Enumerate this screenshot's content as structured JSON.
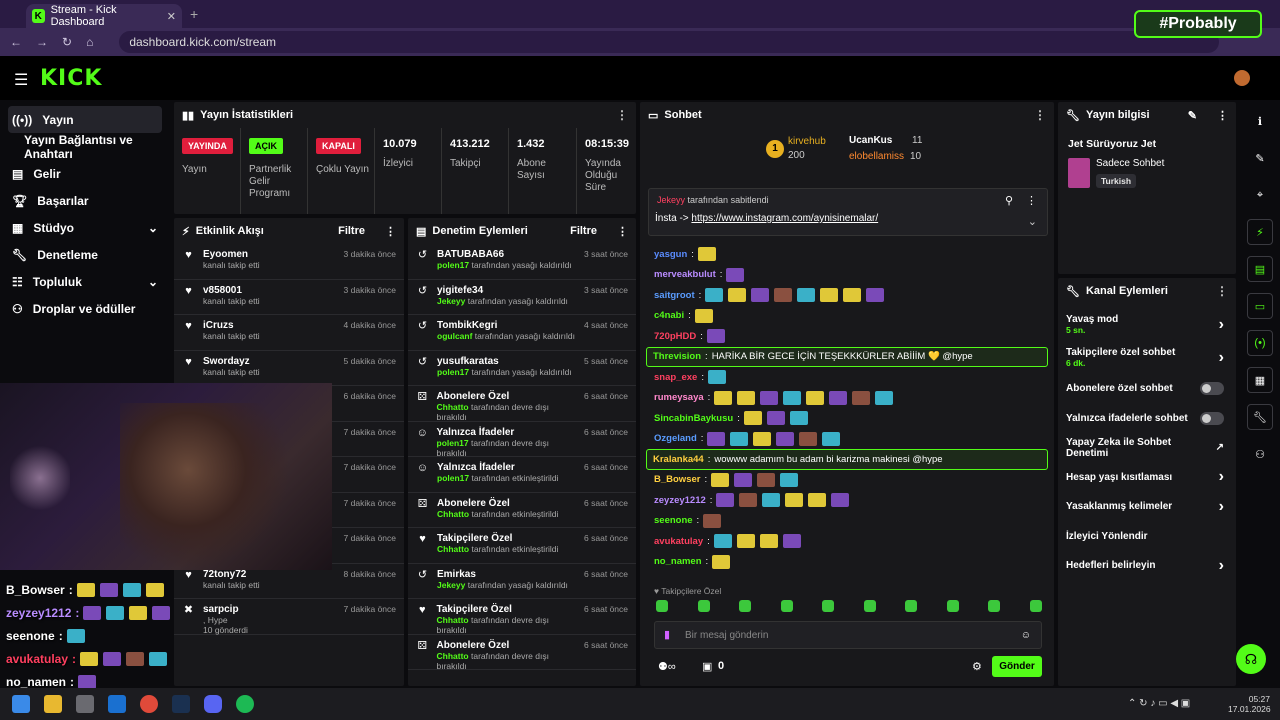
{
  "browser": {
    "tab_title": "Stream - Kick Dashboard",
    "url": "dashboard.kick.com/stream",
    "watermark": "#Probably"
  },
  "logo": "KICK",
  "sidebar": {
    "items": [
      {
        "label": "Yayın",
        "icon": "broadcast-icon"
      },
      {
        "label": "Yayın Bağlantısı ve Anahtarı",
        "icon": ""
      },
      {
        "label": "Gelir",
        "icon": "money-icon"
      },
      {
        "label": "Başarılar",
        "icon": "trophy-icon"
      },
      {
        "label": "Stüdyo",
        "icon": "studio-icon"
      },
      {
        "label": "Denetleme",
        "icon": "wrench-icon"
      },
      {
        "label": "Topluluk",
        "icon": "community-icon"
      },
      {
        "label": "Droplar ve ödüller",
        "icon": "gift-icon"
      }
    ]
  },
  "stats": {
    "title": "Yayın İstatistikleri",
    "live_badge": "YAYINDA",
    "live_label": "Yayın",
    "partner_badge": "AÇIK",
    "partner_label": "Partnerlik Gelir Programı",
    "multi_badge": "KAPALI",
    "multi_label": "Çoklu Yayın",
    "viewers": "10.079",
    "viewers_label": "İzleyici",
    "followers": "413.212",
    "followers_label": "Takipçi",
    "subs": "1.432",
    "subs_label": "Abone Sayısı",
    "uptime": "08:15:39",
    "uptime_label": "Yayında Olduğu Süre"
  },
  "activity": {
    "title": "Etkinlik Akışı",
    "filter": "Filtre",
    "rows": [
      {
        "name": "Eyoomen",
        "sub": "kanalı takip etti",
        "time": "3 dakika önce"
      },
      {
        "name": "v858001",
        "sub": "kanalı takip etti",
        "time": "3 dakika önce"
      },
      {
        "name": "iCruzs",
        "sub": "kanalı takip etti",
        "time": "4 dakika önce"
      },
      {
        "name": "Swordayz",
        "sub": "kanalı takip etti",
        "time": "5 dakika önce"
      },
      {
        "name": "",
        "sub": "",
        "time": "6 dakika önce"
      },
      {
        "name": "",
        "sub": "",
        "time": "7 dakika önce"
      },
      {
        "name": "",
        "sub": "",
        "time": "7 dakika önce"
      },
      {
        "name": "",
        "sub": "",
        "time": "7 dakika önce"
      },
      {
        "name": "",
        "sub": "10 gönderdi",
        "time": "7 dakika önce"
      },
      {
        "name": "72tony72",
        "sub": "kanalı takip etti",
        "time": "8 dakika önce"
      },
      {
        "name": "sarpcip",
        "sub": ", Hype",
        "sub2": "10 gönderdi",
        "time": "7 dakika önce"
      }
    ]
  },
  "moderation": {
    "title": "Denetim Eylemleri",
    "filter": "Filtre",
    "rows": [
      {
        "name": "BATUBABA66",
        "who": "polen17",
        "sub": "tarafından yasağı kaldırıldı",
        "time": "3 saat önce"
      },
      {
        "name": "yigitefe34",
        "who": "Jekeyy",
        "sub": "tarafından yasağı kaldırıldı",
        "time": "3 saat önce"
      },
      {
        "name": "TombikKegri",
        "who": "ogulcanf",
        "sub": "tarafından yasağı kaldırıldı",
        "time": "4 saat önce"
      },
      {
        "name": "yusufkaratas",
        "who": "polen17",
        "sub": "tarafından yasağı kaldırıldı",
        "time": "5 saat önce"
      },
      {
        "name": "Abonelere Özel",
        "who": "Chhatto",
        "sub": "tarafından devre dışı bırakıldı",
        "time": "6 saat önce"
      },
      {
        "name": "Yalnızca İfadeler",
        "who": "polen17",
        "sub": "tarafından devre dışı bırakıldı",
        "time": "6 saat önce"
      },
      {
        "name": "Yalnızca İfadeler",
        "who": "polen17",
        "sub": "tarafından etkinleştirildi",
        "time": "6 saat önce"
      },
      {
        "name": "Abonelere Özel",
        "who": "Chhatto",
        "sub": "tarafından etkinleştirildi",
        "time": "6 saat önce"
      },
      {
        "name": "Takipçilere Özel",
        "who": "Chhatto",
        "sub": "tarafından etkinleştirildi",
        "time": "6 saat önce"
      },
      {
        "name": "Emirkas",
        "who": "Jekeyy",
        "sub": "tarafından yasağı kaldırıldı",
        "time": "6 saat önce"
      },
      {
        "name": "Takipçilere Özel",
        "who": "Chhatto",
        "sub": "tarafından devre dışı bırakıldı",
        "time": "6 saat önce"
      },
      {
        "name": "Abonelere Özel",
        "who": "Chhatto",
        "sub": "tarafından devre dışı bırakıldı",
        "time": "6 saat önce"
      }
    ]
  },
  "chat": {
    "title": "Sohbet",
    "top_gifter": "kirvehub",
    "top_count": "200",
    "g1": "UcanKus",
    "g1n": "11",
    "g2": "elobellamiss",
    "g2n": "10",
    "pinned_by": "Jekeyy",
    "pinned_text": "tarafından sabitlendi",
    "pinned_msg": "İnsta ->",
    "pinned_link": "https://www.instagram.com/aynisinemalar/",
    "lines": [
      {
        "user": "yasgun",
        "color": "#5a8cff",
        "emotes": 1
      },
      {
        "user": "merveakbulut",
        "color": "#b98cff",
        "emotes": 1
      },
      {
        "user": "saitgroot",
        "color": "#5a9cff",
        "emotes": 8
      },
      {
        "user": "c4nabi",
        "color": "#53fc18",
        "emotes": 1
      },
      {
        "user": "720pHDD",
        "color": "#ff4060",
        "emotes": 1
      },
      {
        "user": "Threvision",
        "color": "#53fc18",
        "msg": "HARİKA BİR GECE İÇİN TEŞEKKKÜRLER ABİİİM 💛 @hype",
        "hl": true
      },
      {
        "user": "snap_exe",
        "color": "#ff4060",
        "emotes": 1
      },
      {
        "user": "rumeysaya",
        "color": "#ff88cc",
        "emotes": 8
      },
      {
        "user": "SincabinBaykusu",
        "color": "#53fc18",
        "emotes": 3
      },
      {
        "user": "Ozgeland",
        "color": "#5a9cff",
        "emotes": 6
      },
      {
        "user": "Kralanka44",
        "color": "#ffd040",
        "msg": "wowww adamım bu adam bi karizma makinesi @hype",
        "hl": true
      },
      {
        "user": "B_Bowser",
        "color": "#ffd040",
        "emotes": 4
      },
      {
        "user": "zeyzey1212",
        "color": "#b98cff",
        "emotes": 6
      },
      {
        "user": "seenone",
        "color": "#53fc18",
        "emotes": 1
      },
      {
        "user": "avukatulay",
        "color": "#ff4060",
        "emotes": 4
      },
      {
        "user": "no_namen",
        "color": "#53fc18",
        "emotes": 1
      }
    ],
    "mode": "Takipçilere Özel",
    "placeholder": "Bir mesaj gönderin",
    "send": "Gönder",
    "viewers_count": "0"
  },
  "info": {
    "title": "Yayın bilgisi",
    "stream_title": "Jet Sürüyoruz Jet",
    "category": "Sadece Sohbet",
    "tag": "Turkish"
  },
  "actions": {
    "title": "Kanal Eylemleri",
    "items": [
      {
        "label": "Yavaş mod",
        "sub": "5 sn.",
        "type": "arrow"
      },
      {
        "label": "Takipçilere özel sohbet",
        "sub": "6 dk.",
        "type": "arrow"
      },
      {
        "label": "Abonelere özel sohbet",
        "type": "toggle"
      },
      {
        "label": "Yalnızca ifadelerle sohbet",
        "type": "toggle"
      },
      {
        "label": "Yapay Zeka ile Sohbet Denetimi",
        "type": "ext"
      },
      {
        "label": "Hesap yaşı kısıtlaması",
        "type": "arrow"
      },
      {
        "label": "Yasaklanmış kelimeler",
        "type": "arrow"
      },
      {
        "label": "İzleyici Yönlendir",
        "type": "none"
      },
      {
        "label": "Hedefleri belirleyin",
        "type": "arrow"
      }
    ]
  },
  "overlay": [
    {
      "user": "B_Bowser",
      "color": "#fff"
    },
    {
      "user": "zeyzey1212",
      "color": "#b98cff"
    },
    {
      "user": "seenone",
      "color": "#fff"
    },
    {
      "user": "avukatulay",
      "color": "#ff4060"
    },
    {
      "user": "no_namen",
      "color": "#fff"
    }
  ],
  "clock": {
    "time": "05:27",
    "date": "17.01.2026"
  }
}
